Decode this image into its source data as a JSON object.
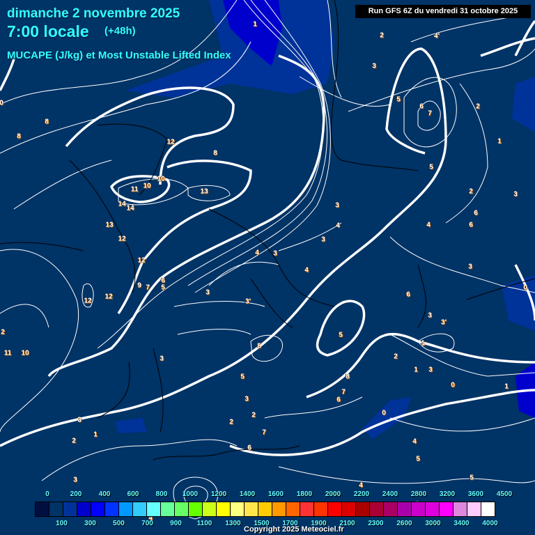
{
  "header": {
    "date": "dimanche 2 novembre 2025",
    "time": "7:00 locale",
    "lead": "(+48h)",
    "parameter": "MUCAPE (J/kg) et Most Unstable Lifted Index",
    "run": "Run GFS 6Z du vendredi 31 octobre 2025"
  },
  "legend": {
    "colors": [
      "#000f40",
      "#003366",
      "#003399",
      "#0000cc",
      "#0000ff",
      "#0033ff",
      "#0099ff",
      "#33ccff",
      "#66ffff",
      "#66ff99",
      "#66ff66",
      "#66ff00",
      "#ccff1a",
      "#ffff00",
      "#ffff80",
      "#ffe64d",
      "#ffcc00",
      "#ff9900",
      "#ff6600",
      "#ff3333",
      "#ff3300",
      "#ff0000",
      "#dd0000",
      "#aa0000",
      "#aa0033",
      "#aa0066",
      "#aa00aa",
      "#cc00cc",
      "#dd00dd",
      "#ff00ff",
      "#dd88dd",
      "#ffccff",
      "#ffffff"
    ],
    "labels": [
      "0",
      "100",
      "200",
      "300",
      "400",
      "500",
      "600",
      "700",
      "800",
      "900",
      "1000",
      "1100",
      "1200",
      "1300",
      "1400",
      "1500",
      "1600",
      "1700",
      "1800",
      "1900",
      "2000",
      "2100",
      "2200",
      "2300",
      "2400",
      "2600",
      "2800",
      "3000",
      "3200",
      "3400",
      "3600",
      "4000",
      "4500"
    ]
  },
  "lifted_index_labels": [
    "4'",
    "2",
    "3",
    "5",
    "6",
    "7",
    "2",
    "1",
    "5",
    "2",
    "6",
    "6",
    "4",
    "3",
    "3",
    "0",
    "6",
    "3",
    "3'",
    "1",
    "5",
    "2",
    "3",
    "1",
    "0",
    "1",
    "8",
    "7",
    "6",
    "0",
    "4",
    "5",
    "5",
    "4",
    "1",
    "8",
    "8",
    "12",
    "8",
    "10",
    "10",
    "11",
    "13",
    "14",
    "14",
    "13",
    "12",
    "12",
    "3",
    "4",
    "3",
    "4",
    "3",
    "4",
    "9",
    "7",
    "6",
    "5",
    "3",
    "3'",
    "12",
    "12",
    "2",
    "11",
    "10",
    "3",
    "5",
    "5",
    "3",
    "2",
    "2",
    "7",
    "6",
    "3",
    "1",
    "2",
    "3",
    "0",
    "4"
  ],
  "colors": {
    "background": "#003366",
    "mucape_low": "#003399",
    "mucape_mid": "#0000cc",
    "title": "#33ffff"
  },
  "copyright": "Copyright 2025 Meteociel.fr"
}
